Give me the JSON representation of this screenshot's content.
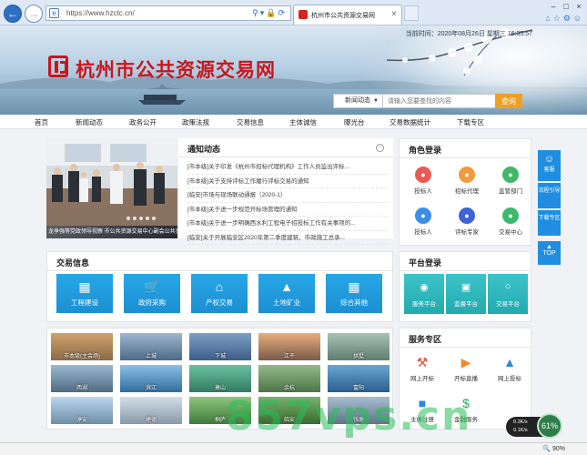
{
  "browser": {
    "url": "https://www.hzctc.cn/",
    "tab_title": "杭州市公共资源交易网",
    "zoom": "90%"
  },
  "header": {
    "site_title": "杭州市公共资源交易网",
    "datetime": "当前时间：2020年08月26日 星期三 16:35:57",
    "search": {
      "category": "新闻动态",
      "placeholder": "请输入您要查找的内容",
      "button": "查询"
    }
  },
  "nav": [
    "首页",
    "新闻动态",
    "政务公开",
    "政策法规",
    "交易信息",
    "主体诚信",
    "曝光台",
    "交易数据统计",
    "下载专区"
  ],
  "slider": {
    "caption": "龙争强等党政领导视察  市公共资源交易中心副会公共资源交易工"
  },
  "notices": {
    "title": "通知动态",
    "items": [
      "[市本级]关于印发《杭州市招标代理机构》工作人员监出评标...",
      "[市本级]关于支持评标工作履行评标交易的通知",
      "[临安]市场与现场联动通报（2020-1）",
      "[市本级]关于进一步规范开标场管理的通知",
      "[市本级]关于进一步明确西水利工程电子招投标工作有关事项的...",
      "[临安]关于开展临安区2020年第二季度建筑、市政施工总承..."
    ]
  },
  "role_login": {
    "title": "角色登录",
    "items": [
      {
        "label": "投标人",
        "color": "#ea5a52",
        "icon": "person-icon"
      },
      {
        "label": "招标代理",
        "color": "#f39a3e",
        "icon": "agent-icon"
      },
      {
        "label": "监管部门",
        "color": "#3fb86b",
        "icon": "supervisor-icon"
      },
      {
        "label": "投标人",
        "color": "#3a8ee6",
        "icon": "bidder-icon"
      },
      {
        "label": "评标专家",
        "color": "#3f63d6",
        "icon": "expert-icon"
      },
      {
        "label": "交易中心",
        "color": "#3fb86b",
        "icon": "center-icon"
      }
    ]
  },
  "trade_info": {
    "title": "交易信息",
    "tiles": [
      {
        "label": "工程建设",
        "icon": "building-icon"
      },
      {
        "label": "政府采购",
        "icon": "cart-icon"
      },
      {
        "label": "产权交易",
        "icon": "house-icon"
      },
      {
        "label": "土地矿业",
        "icon": "land-icon"
      },
      {
        "label": "综合其他",
        "icon": "grid-icon"
      }
    ]
  },
  "platform_login": {
    "title": "平台登录",
    "tiles": [
      {
        "label": "服务平台",
        "icon": "service-icon"
      },
      {
        "label": "监督平台",
        "icon": "monitor-icon"
      },
      {
        "label": "交易平台",
        "icon": "trade-icon"
      }
    ]
  },
  "gallery": [
    "市本级(主会场)",
    "上城",
    "下城",
    "江干",
    "拱墅",
    "西湖",
    "滨江",
    "萧山",
    "余杭",
    "富阳",
    "淳安",
    "建德",
    "桐庐",
    "临安",
    "钱塘"
  ],
  "service_zone": {
    "title": "服务专区",
    "items": [
      {
        "label": "网上开标",
        "icon": "gavel-icon"
      },
      {
        "label": "开标直播",
        "icon": "video-icon"
      },
      {
        "label": "网上投标",
        "icon": "upload-icon"
      },
      {
        "label": "主体注册",
        "icon": "register-icon"
      },
      {
        "label": "金融服务",
        "icon": "finance-icon"
      }
    ]
  },
  "float_bar": {
    "wechat": "客服",
    "guide": "流程引导",
    "download": "下载专区",
    "top": "TOP"
  },
  "overlay": {
    "watermark": "857vps.cn",
    "speed_pct": "61%",
    "speed_up": "0.3K/s",
    "speed_down": "0.1K/s"
  }
}
